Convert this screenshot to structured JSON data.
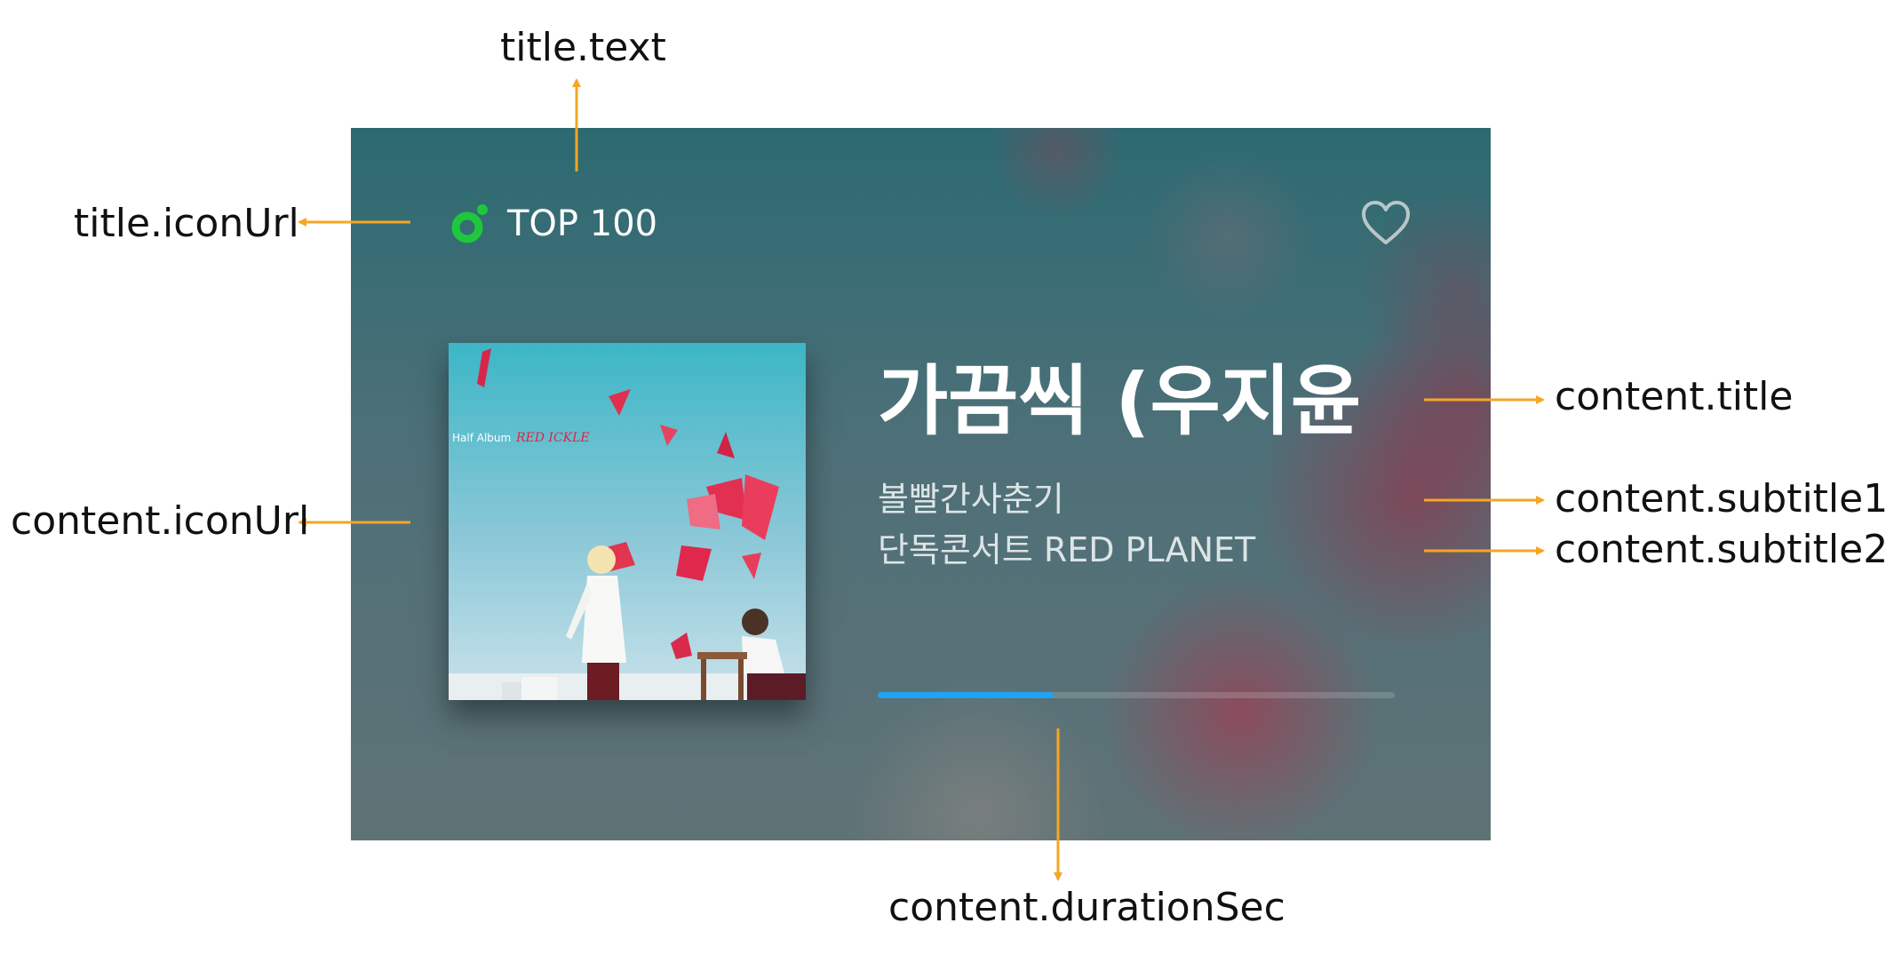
{
  "card": {
    "title": {
      "text": "TOP 100",
      "icon": "ring-logo-icon",
      "icon_color": "#1ec83c"
    },
    "favorite_icon": "heart-icon",
    "content": {
      "album_icon": "album-cover-image",
      "album_label": "Half Album",
      "album_name": "RED ICKLE",
      "title": "가끔씩 (우지윤",
      "subtitle1": "볼빨간사춘기",
      "subtitle2": "단독콘서트 RED PLANET",
      "progress_fraction": 0.34,
      "progress_color": "#1fa3f2"
    }
  },
  "annotations": {
    "title_text": "title.text",
    "title_icon_url": "title.iconUrl",
    "content_icon_url": "content.iconUrl",
    "content_title": "content.title",
    "content_subtitle1": "content.subtitle1",
    "content_subtitle2": "content.subtitle2",
    "content_duration_sec": "content.durationSec",
    "arrow_color": "#f5a623"
  }
}
